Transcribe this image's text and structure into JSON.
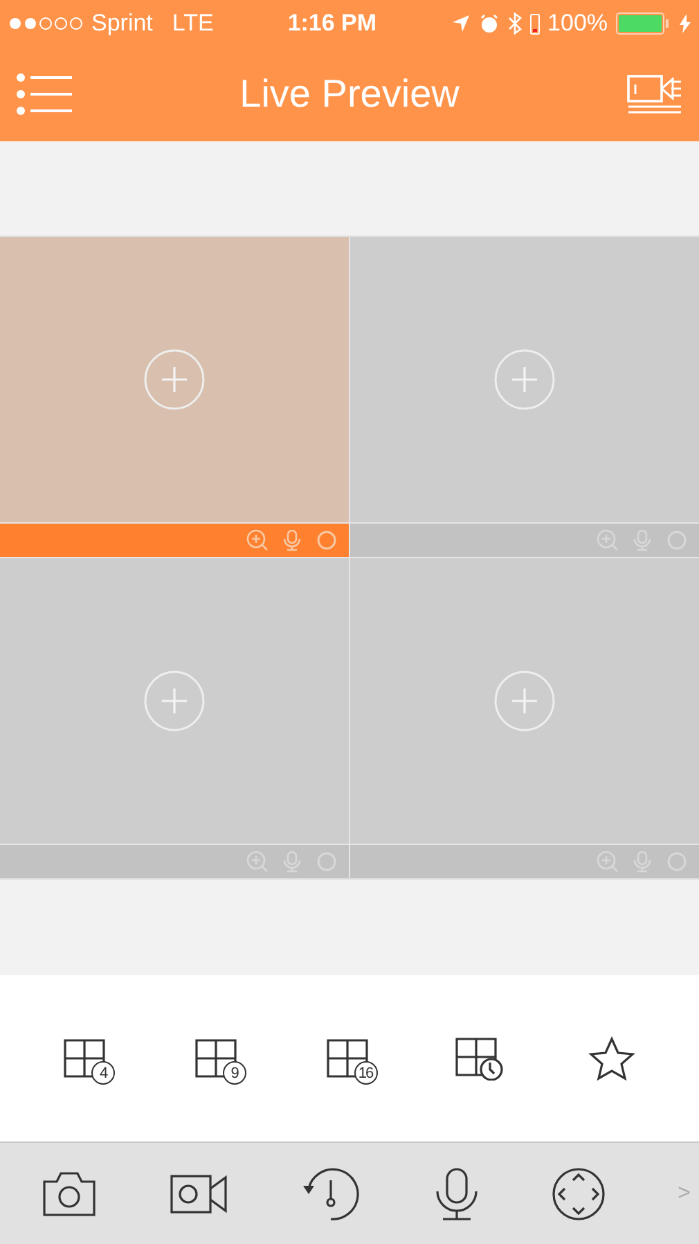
{
  "status_bar": {
    "carrier": "Sprint",
    "network": "LTE",
    "time": "1:16 PM",
    "battery": "100%"
  },
  "nav_bar": {
    "title": "Live Preview"
  },
  "tiles": [
    {
      "selected": true
    },
    {
      "selected": false
    },
    {
      "selected": false
    },
    {
      "selected": false
    }
  ],
  "layout_buttons": [
    {
      "kind": "grid",
      "badge": "4"
    },
    {
      "kind": "grid",
      "badge": "9"
    },
    {
      "kind": "grid",
      "badge": "16"
    },
    {
      "kind": "clock"
    },
    {
      "kind": "star"
    }
  ],
  "toolbar": [
    {
      "kind": "camera"
    },
    {
      "kind": "video"
    },
    {
      "kind": "playback"
    },
    {
      "kind": "mic"
    },
    {
      "kind": "ptz"
    }
  ],
  "more": ">"
}
